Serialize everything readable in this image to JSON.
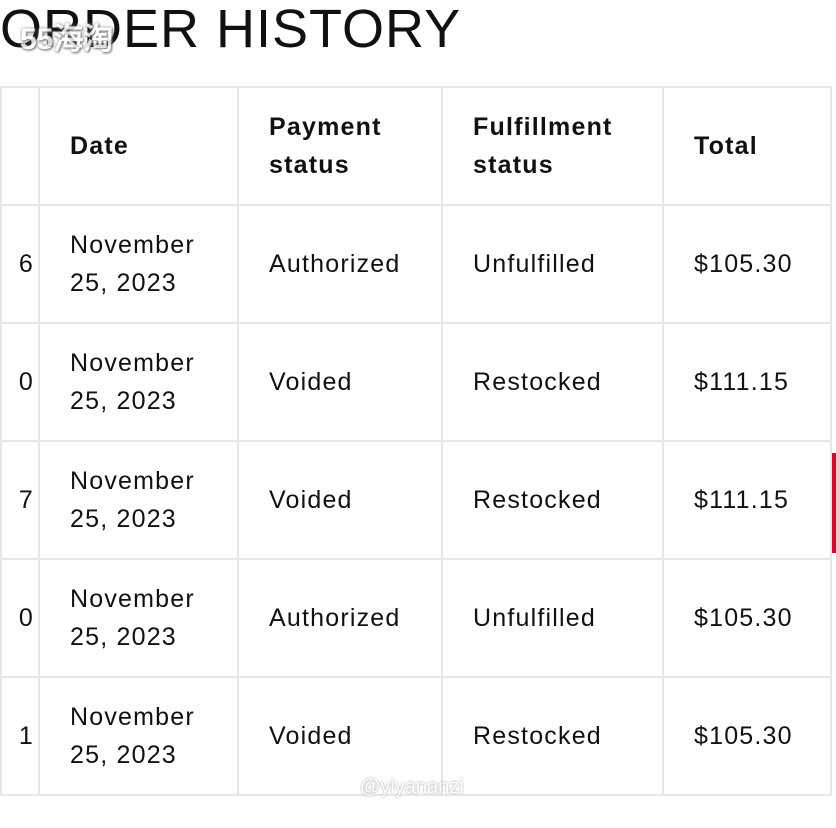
{
  "page_title": "ORDER HISTORY",
  "watermarks": [
    "55海淘",
    "@yiyananzi"
  ],
  "table": {
    "headers": [
      "",
      "Date",
      "Payment status",
      "Fulfillment status",
      "Total"
    ],
    "rows": [
      {
        "order": "6",
        "date": "November 25, 2023",
        "payment": "Authorized",
        "fulfillment": "Unfulfilled",
        "total": "$105.30"
      },
      {
        "order": "0",
        "date": "November 25, 2023",
        "payment": "Voided",
        "fulfillment": "Restocked",
        "total": "$111.15"
      },
      {
        "order": "7",
        "date": "November 25, 2023",
        "payment": "Voided",
        "fulfillment": "Restocked",
        "total": "$111.15"
      },
      {
        "order": "0",
        "date": "November 25, 2023",
        "payment": "Authorized",
        "fulfillment": "Unfulfilled",
        "total": "$105.30"
      },
      {
        "order": "1",
        "date": "November 25, 2023",
        "payment": "Voided",
        "fulfillment": "Restocked",
        "total": "$105.30"
      }
    ]
  },
  "colors": {
    "accent": "#c8102e",
    "border": "#e6e6e6"
  }
}
